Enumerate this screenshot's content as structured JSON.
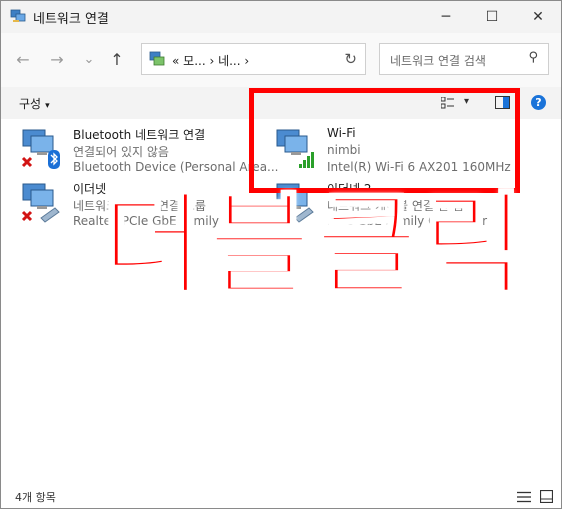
{
  "window": {
    "title": "네트워크 연결",
    "controls": {
      "minimize": "─",
      "maximize": "☐",
      "close": "✕"
    }
  },
  "nav": {
    "back_icon": "←",
    "forward_icon": "→",
    "recent_icon": "⌄",
    "up_icon": "↑",
    "breadcrumb": "« 모... › 네... ›",
    "refresh_icon": "↻",
    "search_placeholder": "네트워크 연결 검색",
    "search_icon": "⚲"
  },
  "command_bar": {
    "organize_label": "구성",
    "organize_caret": "▾",
    "view_caret": "▾",
    "help_label": "?"
  },
  "connections": [
    {
      "name": "Bluetooth 네트워크 연결",
      "status": "연결되어 있지 않음",
      "device": "Bluetooth Device (Personal Area..."
    },
    {
      "name": "Wi-Fi",
      "status": "nimbi",
      "device": "Intel(R) Wi-Fi 6 AX201 160MHz"
    },
    {
      "name": "이더넷",
      "status": "네트워크 케이블 연결 그룹",
      "device": "Realtek PCIe GbE Family Co..."
    },
    {
      "name": "이더넷 2",
      "status": "네트워크 케이블 연결 안 됨",
      "device": "PCIe GbE Family Controller"
    }
  ],
  "overlay": {
    "caption": "더블클릭",
    "accent_color": "#ff0000"
  },
  "status_bar": {
    "item_count": "4개 항목"
  }
}
